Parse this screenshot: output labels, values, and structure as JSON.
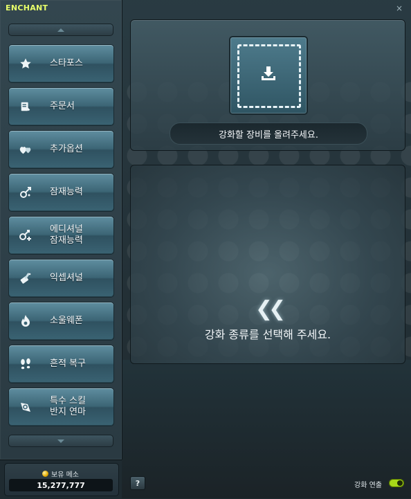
{
  "window": {
    "title": "ENCHANT",
    "close_symbol": "×"
  },
  "sidebar": {
    "items": [
      {
        "label": "스타포스",
        "icon": "star-icon"
      },
      {
        "label": "주문서",
        "icon": "scroll-icon"
      },
      {
        "label": "추가옵션",
        "icon": "flame-hearts-icon"
      },
      {
        "label": "잠재능력",
        "icon": "cube-potential-icon"
      },
      {
        "label": "에디셔널\n잠재능력",
        "icon": "additional-potential-icon"
      },
      {
        "label": "익셉셔널",
        "icon": "hammer-icon"
      },
      {
        "label": "소울웨폰",
        "icon": "soul-flame-icon"
      },
      {
        "label": "흔적 복구",
        "icon": "footprint-icon"
      },
      {
        "label": "특수 스킬\n반지 연마",
        "icon": "ring-grind-icon"
      }
    ]
  },
  "meso": {
    "label": "보유 메소",
    "value": "15,277,777"
  },
  "upload": {
    "text": "강화할 장비를 올려주세요."
  },
  "select": {
    "symbol": "❮❮",
    "text": "강화 종류를 선택해 주세요."
  },
  "footer": {
    "help": "?",
    "toggle_label": "강화 연출",
    "toggle_state": "on"
  },
  "colors": {
    "title": "#e8ff6a",
    "toggle_on": "#a8d818",
    "button_top": "#5f8ea0",
    "button_bottom": "#2f5160"
  }
}
